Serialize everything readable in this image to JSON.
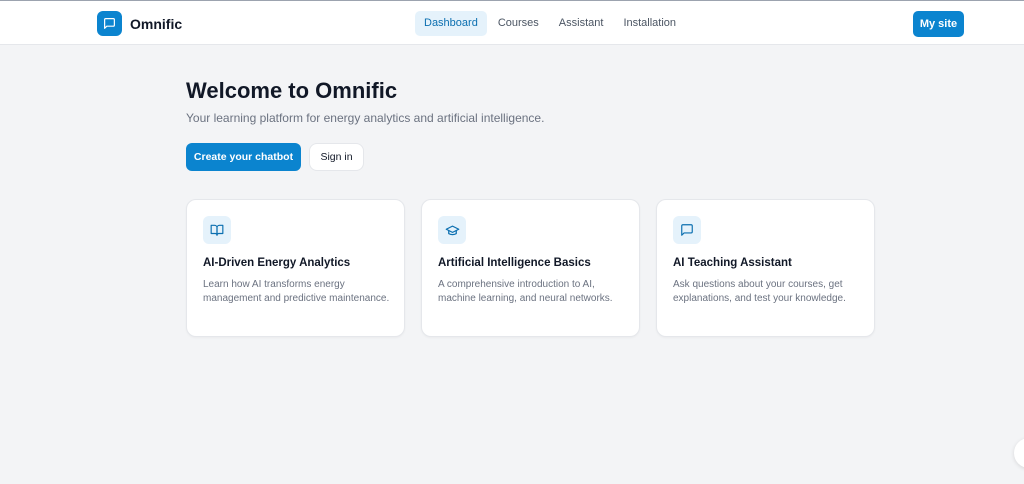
{
  "brand": {
    "name": "Omnific",
    "icon": "chat-bubble-icon"
  },
  "nav": {
    "items": [
      {
        "label": "Dashboard",
        "active": true
      },
      {
        "label": "Courses",
        "active": false
      },
      {
        "label": "Assistant",
        "active": false
      },
      {
        "label": "Installation",
        "active": false
      }
    ]
  },
  "header": {
    "my_site_label": "My site"
  },
  "hero": {
    "title": "Welcome to Omnific",
    "subtitle": "Your learning platform for energy analytics and artificial intelligence.",
    "primary_button": "Create your chatbot",
    "secondary_button": "Sign in"
  },
  "cards": [
    {
      "icon": "open-book-icon",
      "title": "AI-Driven Energy Analytics",
      "description": "Learn how AI transforms energy management and predictive maintenance."
    },
    {
      "icon": "graduation-cap-icon",
      "title": "Artificial Intelligence Basics",
      "description": "A comprehensive introduction to AI, machine learning, and neural networks."
    },
    {
      "icon": "chat-bubble-icon",
      "title": "AI Teaching Assistant",
      "description": "Ask questions about your courses, get explanations, and test your knowledge."
    }
  ],
  "colors": {
    "accent": "#0b84cf",
    "accent_soft": "#e5f2fb",
    "background": "#f3f4f6",
    "text_primary": "#111827",
    "text_muted": "#6b7280"
  }
}
